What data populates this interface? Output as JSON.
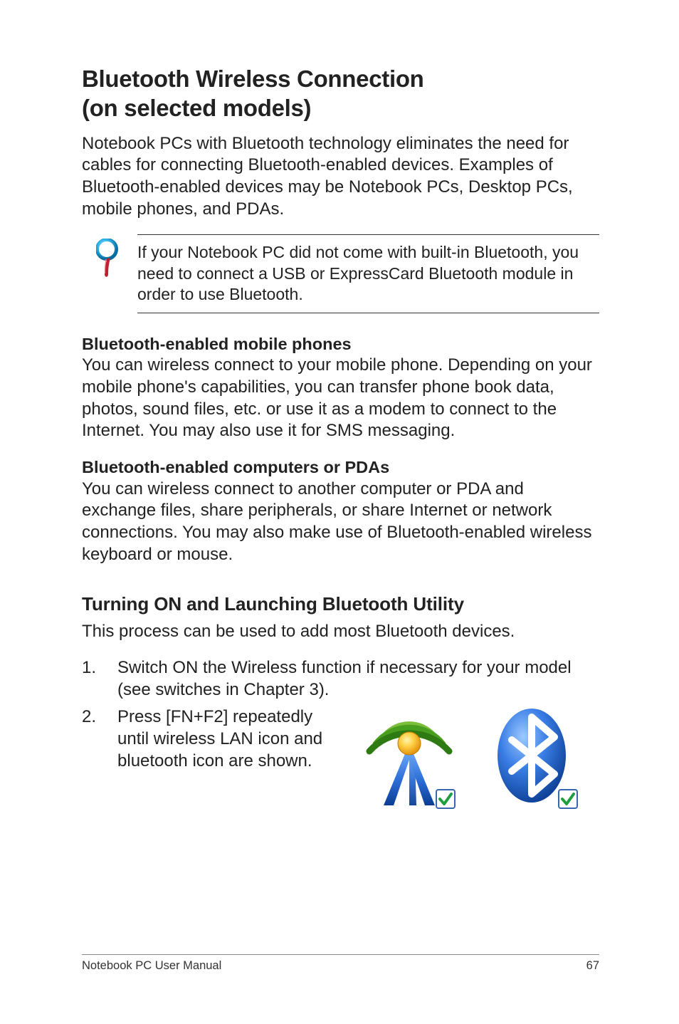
{
  "title_line1": "Bluetooth Wireless Connection",
  "title_line2": "(on selected models)",
  "intro": "Notebook PCs with Bluetooth technology eliminates the need for cables for connecting Bluetooth-enabled devices. Examples of Bluetooth-enabled devices may be Notebook PCs, Desktop PCs, mobile phones, and PDAs.",
  "note": "If your Notebook PC did not come with built-in Bluetooth, you need to connect a USB or ExpressCard Bluetooth module in order to use Bluetooth.",
  "subhead1": "Bluetooth-enabled mobile phones",
  "para1": "You can wireless connect to your mobile phone. Depending on your mobile phone's capabilities, you can transfer phone book data, photos, sound files, etc. or use it as a modem to connect to the Internet. You may also use it for SMS messaging.",
  "subhead2": "Bluetooth-enabled computers or PDAs",
  "para2": "You can wireless connect to another computer or PDA and exchange files, share peripherals, or share Internet or network connections. You may also make use of Bluetooth-enabled wireless keyboard or mouse.",
  "h2": "Turning ON and Launching Bluetooth Utility",
  "lead": "This process can be used to add most Bluetooth devices.",
  "step1_num": "1.",
  "step1": "Switch ON the Wireless function if necessary for your model (see switches in Chapter 3).",
  "step2_num": "2.",
  "step2": "Press [FN+F2] repeatedly until wireless LAN icon and bluetooth icon are shown.",
  "footer_left": "Notebook PC User Manual",
  "footer_right": "67",
  "icons": {
    "note": "magnifier-icon",
    "wlan": "wireless-antenna-icon",
    "bt": "bluetooth-icon"
  }
}
